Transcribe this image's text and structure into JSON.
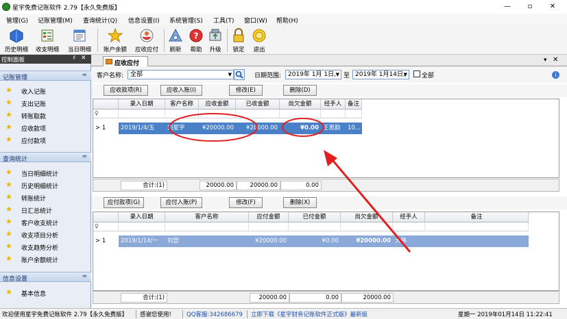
{
  "window": {
    "title": "星宇免费记账软件 2.79【永久免费版】",
    "controls": [
      "—",
      "▫",
      "✕"
    ]
  },
  "menu": [
    "管理(G)",
    "记账管理(M)",
    "查询统计(Q)",
    "信息设置(I)",
    "系统管理(S)",
    "工具(T)",
    "窗口(W)",
    "帮助(H)"
  ],
  "toolbar": [
    {
      "label": "历史明细",
      "icon": "history-detail-icon"
    },
    {
      "label": "收支明细",
      "icon": "income-expense-detail-icon"
    },
    {
      "label": "当日明细",
      "icon": "daily-detail-icon"
    },
    {
      "label": "账户余额",
      "icon": "account-balance-star-icon"
    },
    {
      "label": "应收应付",
      "icon": "receivable-payable-icon"
    },
    {
      "label": "刷新",
      "icon": "refresh-icon"
    },
    {
      "label": "帮助",
      "icon": "help-icon"
    },
    {
      "label": "升级",
      "icon": "upgrade-icon"
    },
    {
      "label": "锁定",
      "icon": "lock-icon"
    },
    {
      "label": "退出",
      "icon": "exit-icon"
    }
  ],
  "panel": {
    "title": "控制面板",
    "pin": "♯",
    "close": "✕",
    "groups": [
      {
        "title": "记账管理",
        "collapse": "≈",
        "items": [
          "收入记账",
          "支出记账",
          "转账取款",
          "应收款项",
          "应付款项"
        ]
      },
      {
        "title": "查询统计",
        "collapse": "≈",
        "items": [
          "当日明细统计",
          "历史明细统计",
          "转账统计",
          "日汇总统计",
          "客户收支统计",
          "收支项目分析",
          "收支趋势分析",
          "账户余额统计"
        ]
      },
      {
        "title": "信息设置",
        "collapse": "≈",
        "items": [
          "基本信息"
        ]
      }
    ]
  },
  "tab": {
    "label": "应收应付",
    "menu": "▾",
    "close": "✕"
  },
  "filter": {
    "customer_label": "客户名称:",
    "customer_value": "全部",
    "date_label": "日期范围:",
    "date_from": "2019年 1月 1日,",
    "to_label": "至",
    "date_to": "2019年 1月14日,",
    "all_label": "全部"
  },
  "receivable": {
    "buttons": [
      "应收款项(R)",
      "应收入账(I)",
      "修改(E)",
      "删除(D)"
    ],
    "columns": [
      "录入日期",
      "客户名称",
      "应收金额",
      "已收金额",
      "尚欠金额",
      "经手人",
      "备注"
    ],
    "rows": [
      {
        "indicator": "> 1",
        "date": "2019/1/4/五",
        "customer": "刘星宇",
        "amount": "¥20000.00",
        "received": "¥20000.00",
        "owed": "¥0.00",
        "handler": "王思韵",
        "note": "10..."
      }
    ],
    "summary": {
      "count": "合计:(1)",
      "amount": "20000.00",
      "received": "20000.00",
      "owed": "0.00"
    }
  },
  "payable": {
    "buttons": [
      "应付款项(G)",
      "应付入账(P)",
      "修改(F)",
      "删除(X)"
    ],
    "columns": [
      "录入日期",
      "客户名称",
      "应付金额",
      "已付金额",
      "尚欠金额",
      "经手人",
      "备注"
    ],
    "rows": [
      {
        "indicator": "> 1",
        "date": "2019/1/14/一",
        "customer": "刘宫",
        "amount": "¥20000.00",
        "paid": "¥0.00",
        "owed": "¥20000.00",
        "handler": "大伟",
        "note": ""
      }
    ],
    "summary": {
      "count": "合计:(1)",
      "amount": "20000.00",
      "paid": "0.00",
      "owed": "20000.00"
    }
  },
  "status": {
    "welcome": "欢迎使用星宇免费记账软件 2.79【永久免费版】",
    "thanks": "感谢您使用!",
    "qq": "QQ客服:342686679",
    "download": "立即下载《星宇财务记账软件正式版》最新版",
    "datetime": "星期一 2019年01月14日 11:22:41"
  },
  "colors": {
    "selection": "#4a80c8",
    "annotation": "#e02020",
    "group_header": "#c6d6ee",
    "star": "#f0b400"
  }
}
